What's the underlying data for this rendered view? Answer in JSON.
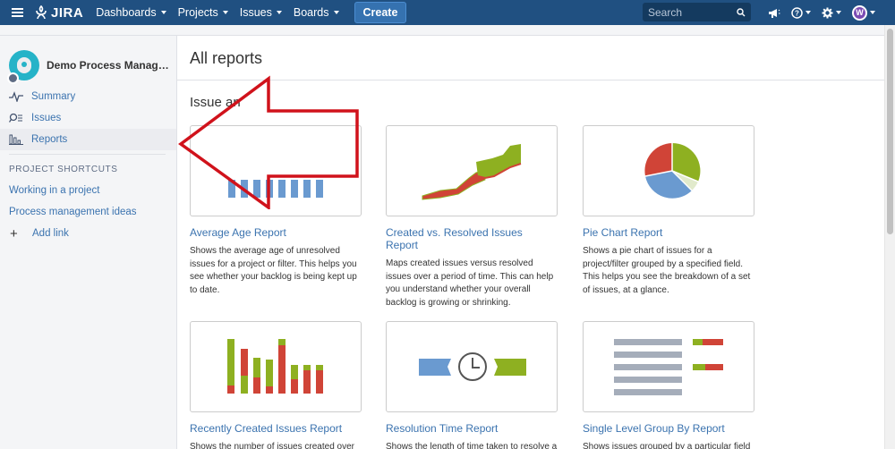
{
  "topbar": {
    "logo_text": "JIRA",
    "nav": [
      "Dashboards",
      "Projects",
      "Issues",
      "Boards"
    ],
    "create_label": "Create",
    "search_placeholder": "Search",
    "icons": [
      "notification-icon",
      "help-icon",
      "settings-icon",
      "user-avatar"
    ]
  },
  "sidebar": {
    "project_name": "Demo Process Manageme...",
    "items": [
      {
        "label": "Summary",
        "icon": "summary-pulse-icon"
      },
      {
        "label": "Issues",
        "icon": "issues-search-icon"
      },
      {
        "label": "Reports",
        "icon": "reports-chart-icon",
        "active": true
      }
    ],
    "shortcuts_heading": "PROJECT SHORTCUTS",
    "shortcuts": [
      "Working in a project",
      "Process management ideas"
    ],
    "add_link": "Add link"
  },
  "main": {
    "page_title": "All reports",
    "section_title": "Issue an",
    "reports": [
      {
        "title": "Average Age Report",
        "desc": "Shows the average age of unresolved issues for a project or filter. This helps you see whether your backlog is being kept up to date."
      },
      {
        "title": "Created vs. Resolved Issues Report",
        "desc": "Maps created issues versus resolved issues over a period of time. This can help you understand whether your overall backlog is growing or shrinking."
      },
      {
        "title": "Pie Chart Report",
        "desc": "Shows a pie chart of issues for a project/filter grouped by a specified field. This helps you see the breakdown of a set of issues, at a glance."
      },
      {
        "title": "Recently Created Issues Report",
        "desc": "Shows the number of issues created over a"
      },
      {
        "title": "Resolution Time Report",
        "desc": "Shows the length of time taken to resolve a"
      },
      {
        "title": "Single Level Group By Report",
        "desc": "Shows issues grouped by a particular field"
      }
    ]
  },
  "colors": {
    "nav_bg": "#205081",
    "link": "#3b73af",
    "arrow": "#d0121b",
    "green": "#8eb021",
    "red": "#d04437",
    "blue": "#6a9ad0"
  }
}
